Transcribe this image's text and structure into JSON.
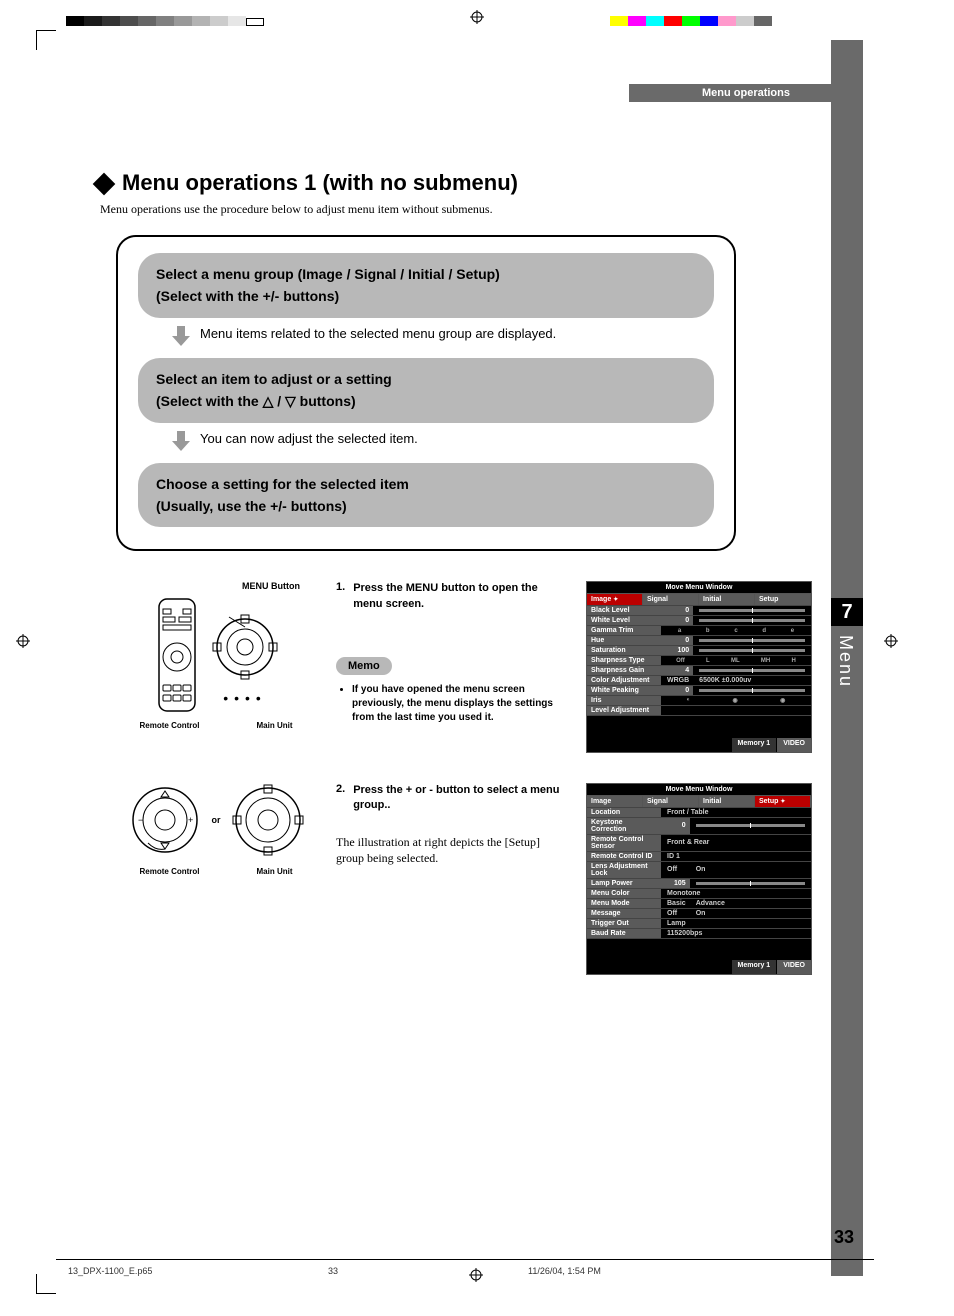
{
  "header": {
    "label": "Menu operations"
  },
  "sidetab": {
    "num": "7",
    "label": "Menu"
  },
  "title": "Menu operations 1 (with no submenu)",
  "intro": "Menu operations use the procedure below to adjust menu item without submenus.",
  "steps": {
    "s1a": "Select a menu group (Image / Signal / Initial / Setup)",
    "s1b": "(Select with the +/- buttons)",
    "s1note": "Menu items related to the selected menu group are displayed.",
    "s2a": "Select an item to adjust or a setting",
    "s2b": "(Select with the △ / ▽ buttons)",
    "s2note": "You can now adjust the selected item.",
    "s3a": "Choose a setting for the selected item",
    "s3b": "(Usually, use the +/- buttons)"
  },
  "devices": {
    "menu_button": "MENU Button",
    "remote": "Remote Control",
    "main_unit": "Main Unit",
    "or": "or"
  },
  "instr": {
    "n1": "1.",
    "t1": "Press the MENU button to open the menu screen.",
    "memo_label": "Memo",
    "memo_bullet": "If you have opened the menu screen previously, the menu displays the settings from the last time you used it.",
    "n2": "2.",
    "t2": "Press the + or - button to select a menu group..",
    "illus": "The illustration at right depicts the [Setup] group being selected."
  },
  "osd1": {
    "title": "Move Menu Window",
    "tabs": [
      "Image",
      "Signal",
      "Initial",
      "Setup"
    ],
    "selected_tab": 0,
    "rows": [
      {
        "label": "Black Level",
        "valnum": "0",
        "slider": true
      },
      {
        "label": "White Level",
        "valnum": "0",
        "slider": true
      },
      {
        "label": "Gamma Trim",
        "seg": [
          "a",
          "b",
          "c",
          "d",
          "e"
        ]
      },
      {
        "label": "Hue",
        "valnum": "0",
        "slider": true
      },
      {
        "label": "Saturation",
        "valnum": "100",
        "slider": true
      },
      {
        "label": "Sharpness Type",
        "seg": [
          "Off",
          "L",
          "ML",
          "MH",
          "H"
        ]
      },
      {
        "label": "Sharpness Gain",
        "valnum": "4",
        "slider": true
      },
      {
        "label": "Color Adjustment",
        "text_l": "WRGB",
        "text_r": "6500K ±0.000uv"
      },
      {
        "label": "White Peaking",
        "valnum": "0",
        "slider": true
      },
      {
        "label": "Iris",
        "icons": true
      },
      {
        "label": "Level Adjustment"
      }
    ],
    "foot_l": "Memory 1",
    "foot_r": "VIDEO"
  },
  "osd2": {
    "title": "Move Menu Window",
    "tabs": [
      "Image",
      "Signal",
      "Initial",
      "Setup"
    ],
    "selected_tab": 3,
    "rows": [
      {
        "label": "Location",
        "text_l": "Front / Table"
      },
      {
        "label": "Keystone Correction",
        "valnum": "0",
        "slider": true
      },
      {
        "label": "Remote Control Sensor",
        "text_l": "Front & Rear"
      },
      {
        "label": "Remote Control ID",
        "text_l": "ID 1"
      },
      {
        "label": "Lens Adjustment Lock",
        "text_l": "Off",
        "text_r": "On"
      },
      {
        "label": "Lamp Power",
        "valnum": "105",
        "slider": true
      },
      {
        "label": "Menu Color",
        "text_l": "Monotone"
      },
      {
        "label": "Menu Mode",
        "text_l": "Basic",
        "text_r": "Advance"
      },
      {
        "label": "Message",
        "text_l": "Off",
        "text_r": "On"
      },
      {
        "label": "Trigger Out",
        "text_l": "Lamp"
      },
      {
        "label": "Baud Rate",
        "text_l": "115200bps"
      }
    ],
    "foot_l": "Memory 1",
    "foot_r": "VIDEO"
  },
  "page_num": "33",
  "footer": {
    "filename": "13_DPX-1100_E.p65",
    "page": "33",
    "datetime": "11/26/04, 1:54 PM"
  }
}
